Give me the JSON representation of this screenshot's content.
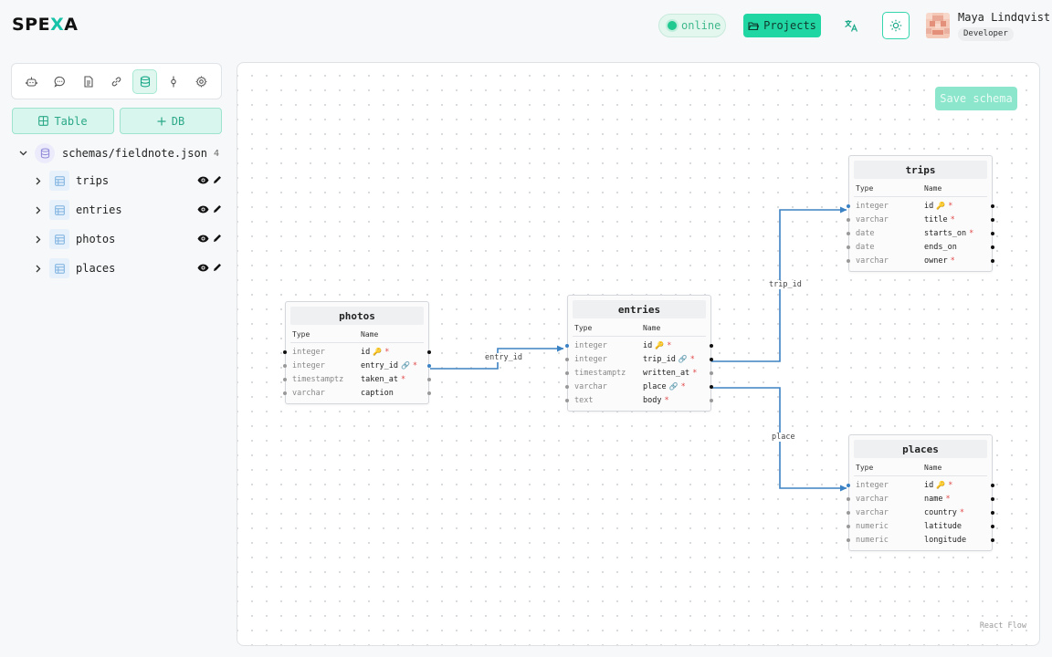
{
  "header": {
    "logo_main": "SPE",
    "logo_accent": "X",
    "logo_tail": "A",
    "status_label": "online",
    "projects_label": "Projects",
    "user_name": "Maya Lindqvist",
    "user_role": "Developer"
  },
  "sidebar": {
    "add_table_label": "Table",
    "add_db_label": "DB",
    "schema_file": "schemas/fieldnote.json",
    "table_count": "4",
    "tables": [
      {
        "label": "trips"
      },
      {
        "label": "entries"
      },
      {
        "label": "photos"
      },
      {
        "label": "places"
      }
    ]
  },
  "canvas": {
    "save_label": "Save schema",
    "attribution": "React Flow",
    "column_header_type": "Type",
    "column_header_name": "Name",
    "edges": [
      {
        "label": "entry_id"
      },
      {
        "label": "trip_id"
      },
      {
        "label": "place"
      }
    ],
    "nodes": {
      "photos": {
        "title": "photos",
        "columns": [
          {
            "type": "integer",
            "name": "id"
          },
          {
            "type": "integer",
            "name": "entry_id"
          },
          {
            "type": "timestamptz",
            "name": "taken_at"
          },
          {
            "type": "varchar",
            "name": "caption"
          }
        ]
      },
      "entries": {
        "title": "entries",
        "columns": [
          {
            "type": "integer",
            "name": "id"
          },
          {
            "type": "integer",
            "name": "trip_id"
          },
          {
            "type": "timestamptz",
            "name": "written_at"
          },
          {
            "type": "varchar",
            "name": "place"
          },
          {
            "type": "text",
            "name": "body"
          }
        ]
      },
      "trips": {
        "title": "trips",
        "columns": [
          {
            "type": "integer",
            "name": "id"
          },
          {
            "type": "varchar",
            "name": "title"
          },
          {
            "type": "date",
            "name": "starts_on"
          },
          {
            "type": "date",
            "name": "ends_on"
          },
          {
            "type": "varchar",
            "name": "owner"
          }
        ]
      },
      "places": {
        "title": "places",
        "columns": [
          {
            "type": "integer",
            "name": "id"
          },
          {
            "type": "varchar",
            "name": "name"
          },
          {
            "type": "varchar",
            "name": "country"
          },
          {
            "type": "numeric",
            "name": "latitude"
          },
          {
            "type": "numeric",
            "name": "longitude"
          }
        ]
      }
    }
  },
  "colors": {
    "accent": "#20d7a4",
    "edge": "#3b82c4",
    "required": "#e24a4a",
    "key": "#e8a21a"
  }
}
